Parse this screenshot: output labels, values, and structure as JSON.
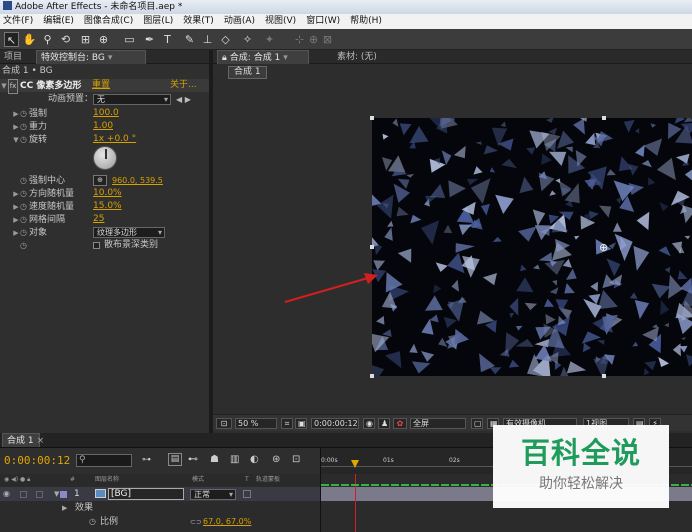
{
  "window": {
    "title": "Adobe After Effects - 未命名项目.aep *"
  },
  "menu": [
    "文件(F)",
    "编辑(E)",
    "图像合成(C)",
    "图层(L)",
    "效果(T)",
    "动画(A)",
    "视图(V)",
    "窗口(W)",
    "帮助(H)"
  ],
  "toolbar": {
    "icons": [
      "selection-tool-icon",
      "hand-tool-icon",
      "zoom-tool-icon",
      "orbit-camera-icon",
      "pan-camera-icon",
      "pan-behind-icon",
      "rectangle-mask-icon",
      "pen-tool-icon",
      "text-tool-icon",
      "brush-icon",
      "clone-stamp-icon",
      "eraser-icon",
      "roto-brush-icon",
      "puppet-pin-icon",
      "axis-local-icon",
      "axis-world-icon",
      "axis-view-icon"
    ]
  },
  "left_panel": {
    "tabs": [
      "项目",
      "特效控制台: BG"
    ],
    "subtitle": "合成 1 • BG",
    "effect": {
      "name": "CC 像素多边形",
      "reset": "重置",
      "about": "关于...",
      "preset_label": "动画预置：",
      "preset_value": "无",
      "properties": [
        {
          "name": "强制",
          "value": "100.0"
        },
        {
          "name": "重力",
          "value": "1.00"
        },
        {
          "name": "旋转",
          "value": "1x +0.0 °"
        },
        {
          "name": "强制中心",
          "value": "960.0, 539.5"
        },
        {
          "name": "方向随机量",
          "value": "10.0%"
        },
        {
          "name": "速度随机量",
          "value": "15.0%"
        },
        {
          "name": "网格间隔",
          "value": "25"
        },
        {
          "name": "对象",
          "value": "纹理多边形"
        }
      ],
      "checkbox_label": "散布景深类别"
    }
  },
  "viewer": {
    "tabs": [
      "合成: 合成 1",
      "素材: (无)"
    ],
    "comp_tab": "合成 1",
    "zoom": "50 %",
    "timecode": "0:00:00:12",
    "resolution": "全屏",
    "camera": "有效摄像机",
    "views": "1视图"
  },
  "timeline": {
    "tab": "合成 1",
    "timecode": "0:00:00:12",
    "ruler_labels": [
      "0:00s",
      "01s",
      "02s"
    ],
    "columns": [
      "#",
      "图层名称",
      "模式",
      "T",
      "轨道蒙板"
    ],
    "layers": [
      {
        "index": "1",
        "name": "[BG]",
        "mode": "正常"
      }
    ],
    "effects_label": "效果",
    "scale_label": "比例",
    "scale_value": "67.0, 67.0%"
  },
  "watermark": {
    "title": "百科全说",
    "subtitle": "助你轻松解决"
  },
  "colors": {
    "accent": "#d7a100",
    "arrow": "#d21f1f",
    "watermark": "#1f9b5b"
  }
}
